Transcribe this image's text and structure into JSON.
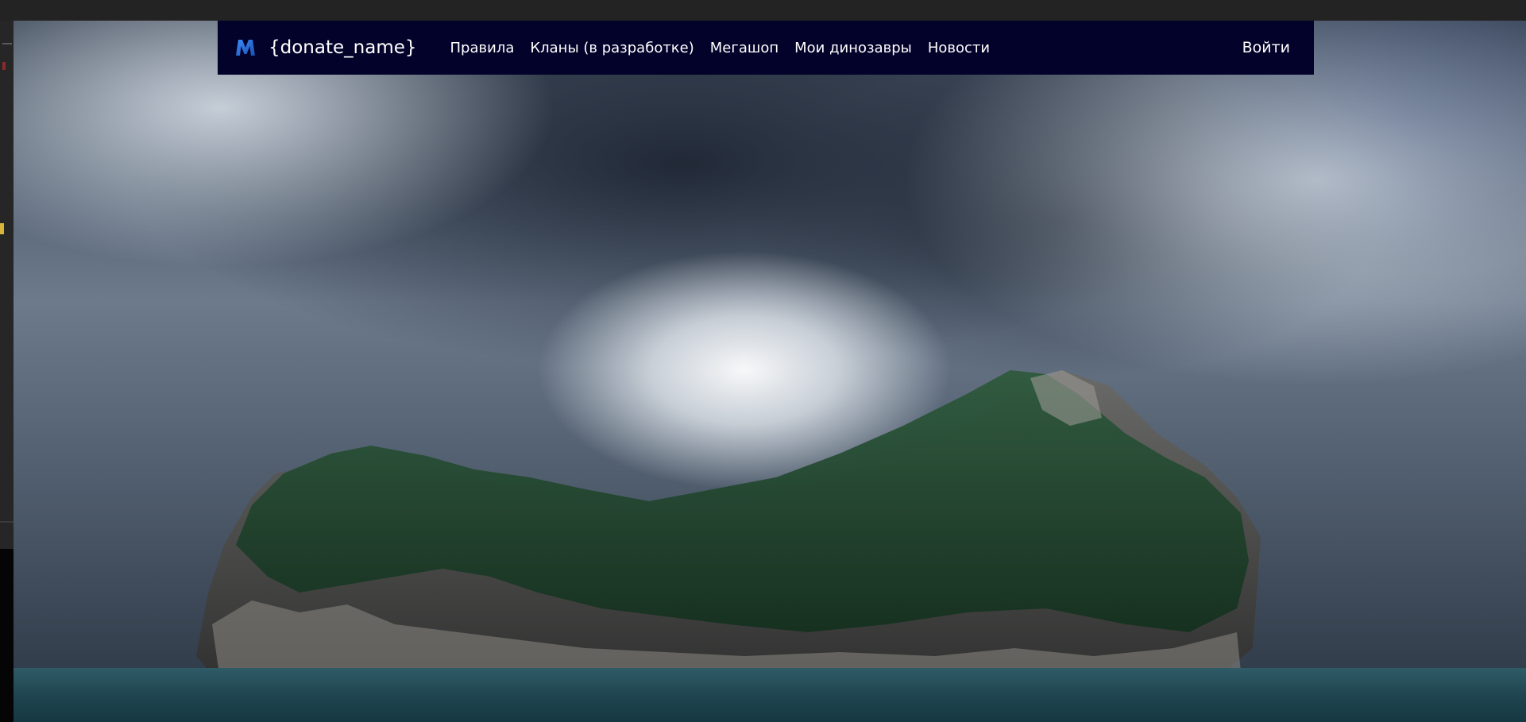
{
  "navbar": {
    "brand_name": "{donate_name}",
    "logo_icon": "m-logo-icon",
    "links": [
      {
        "label": "Правила"
      },
      {
        "label": "Кланы (в разработке)"
      },
      {
        "label": "Мегашоп"
      },
      {
        "label": "Мои динозавры"
      },
      {
        "label": "Новости"
      }
    ],
    "login_label": "Войти"
  },
  "colors": {
    "navbar_bg": "#03022a",
    "logo_blue": "#2b6fd6",
    "text": "#ffffff"
  }
}
